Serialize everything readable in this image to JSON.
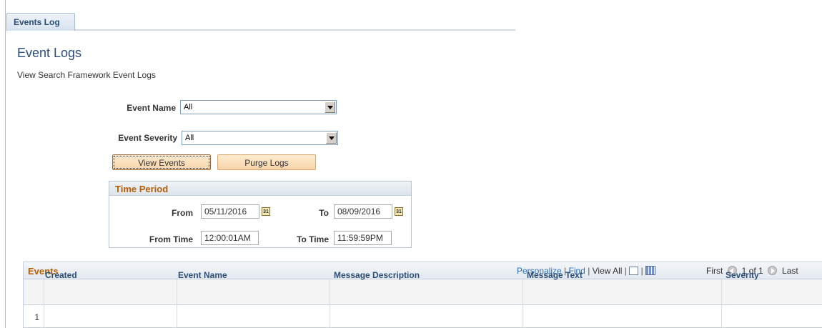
{
  "tabs": [
    {
      "label": "Events Log"
    }
  ],
  "page": {
    "title": "Event Logs",
    "subtitle": "View Search Framework Event Logs"
  },
  "filters": {
    "event_name_label": "Event Name",
    "event_name_value": "All",
    "event_severity_label": "Event Severity",
    "event_severity_value": "All"
  },
  "buttons": {
    "view_events": "View Events",
    "purge_logs": "Purge Logs"
  },
  "time_period": {
    "title": "Time Period",
    "from_label": "From",
    "from_value": "05/11/2016",
    "to_label": "To",
    "to_value": "08/09/2016",
    "from_time_label": "From Time",
    "from_time_value": "12:00:01AM",
    "to_time_label": "To Time",
    "to_time_value": "11:59:59PM"
  },
  "events_grid": {
    "title": "Events",
    "nav": {
      "personalize": "Personalize",
      "find": "Find",
      "view_all": "View All",
      "first": "First",
      "range": "1 of 1",
      "last": "Last"
    },
    "columns": [
      "Created",
      "Event Name",
      "Message Description",
      "Message Text",
      "Severity"
    ],
    "rows": [
      {
        "num": "1"
      }
    ]
  },
  "colors": {
    "title_blue": "#2b4d78",
    "group_orange": "#b45f06",
    "link_blue": "#2b6fb6",
    "button_fill": "#f8d4a8"
  }
}
